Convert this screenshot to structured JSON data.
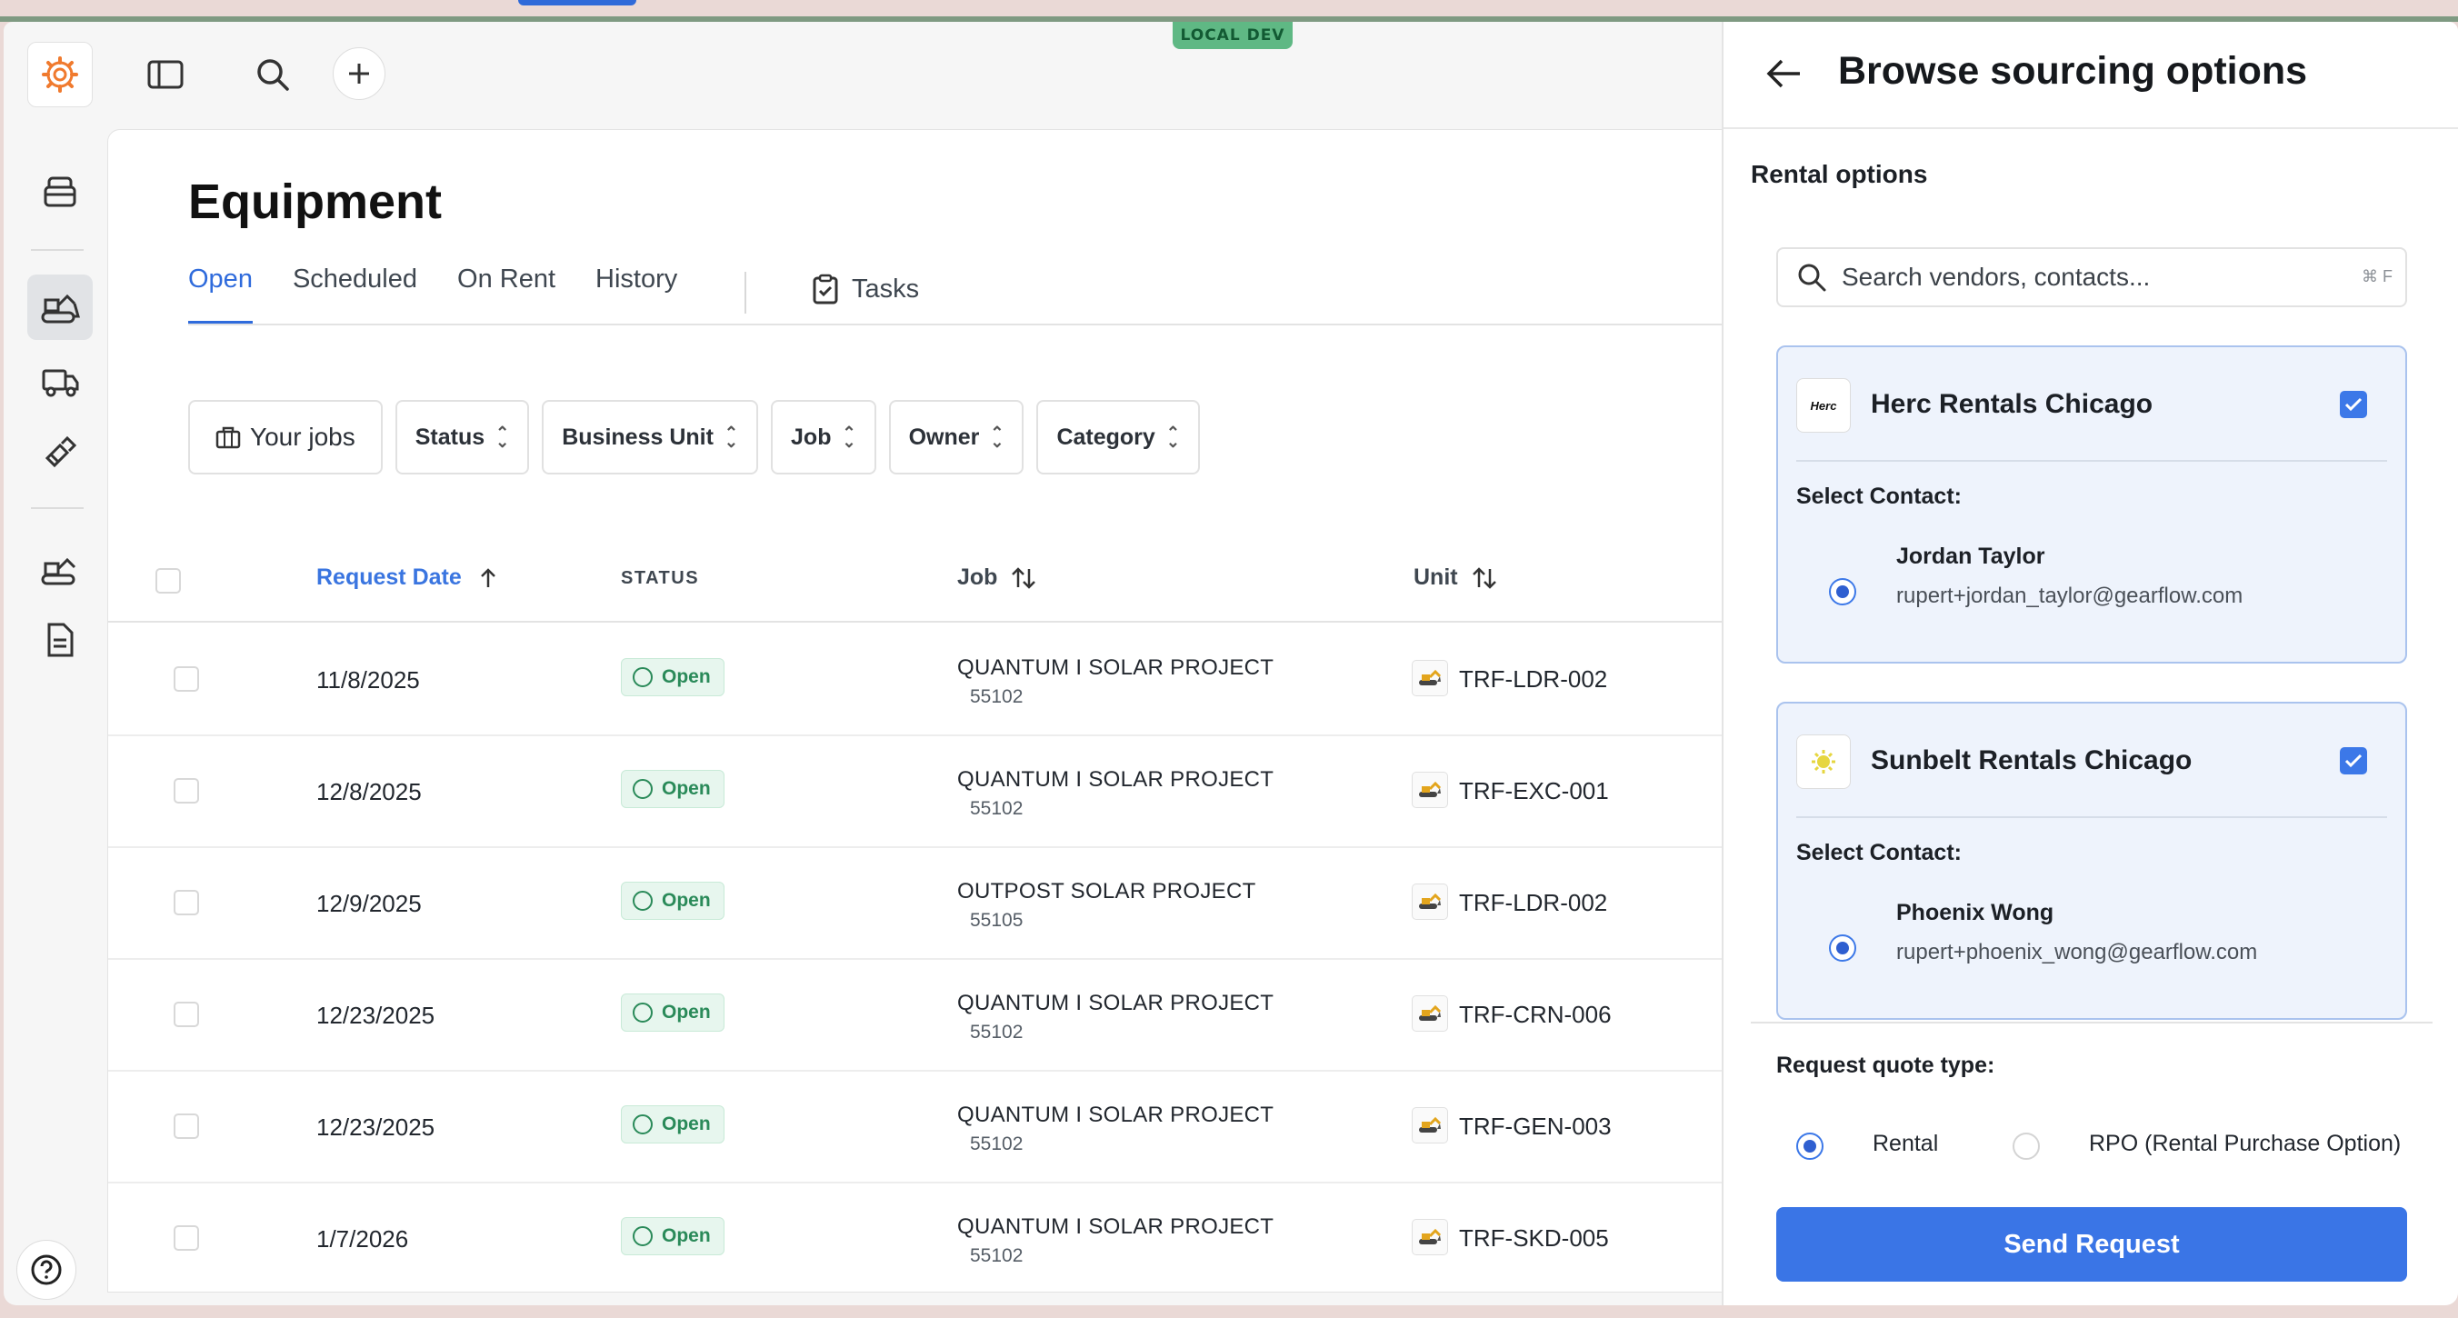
{
  "env_badge": "LOCAL DEV",
  "colors": {
    "accent": "#3a75e6",
    "open_status": "#2a8a59",
    "rail_active": "#e1e3e6"
  },
  "topbar": {
    "icons": [
      "gearflow-logo-icon",
      "sidebar-toggle-icon",
      "search-icon",
      "plus-icon"
    ]
  },
  "rail": {
    "items": [
      "inventory-icon",
      "equipment-icon",
      "truck-icon",
      "tools-icon",
      "excavator-icon",
      "document-icon"
    ],
    "active": "equipment-icon",
    "help": "help-icon"
  },
  "page": {
    "title": "Equipment",
    "tabs": [
      "Open",
      "Scheduled",
      "On Rent",
      "History"
    ],
    "active_tab": "Open",
    "tasks_tab": "Tasks"
  },
  "filters": {
    "your_jobs": "Your jobs",
    "status": "Status",
    "business_unit": "Business Unit",
    "job": "Job",
    "owner": "Owner",
    "category": "Category"
  },
  "table": {
    "headers": {
      "request_date": "Request Date",
      "status": "STATUS",
      "job": "Job",
      "unit": "Unit"
    },
    "rows": [
      {
        "date": "11/8/2025",
        "status": "Open",
        "job": "QUANTUM I SOLAR PROJECT",
        "job_no": "55102",
        "unit": "TRF-LDR-002"
      },
      {
        "date": "12/8/2025",
        "status": "Open",
        "job": "QUANTUM I SOLAR PROJECT",
        "job_no": "55102",
        "unit": "TRF-EXC-001"
      },
      {
        "date": "12/9/2025",
        "status": "Open",
        "job": "OUTPOST SOLAR PROJECT",
        "job_no": "55105",
        "unit": "TRF-LDR-002"
      },
      {
        "date": "12/23/2025",
        "status": "Open",
        "job": "QUANTUM I SOLAR PROJECT",
        "job_no": "55102",
        "unit": "TRF-CRN-006"
      },
      {
        "date": "12/23/2025",
        "status": "Open",
        "job": "QUANTUM I SOLAR PROJECT",
        "job_no": "55102",
        "unit": "TRF-GEN-003"
      },
      {
        "date": "1/7/2026",
        "status": "Open",
        "job": "QUANTUM I SOLAR PROJECT",
        "job_no": "55102",
        "unit": "TRF-SKD-005"
      }
    ]
  },
  "panel": {
    "title": "Browse sourcing options",
    "section": "Rental options",
    "search_placeholder": "Search vendors, contacts...",
    "search_shortcut": "⌘ F",
    "vendors": [
      {
        "name": "Herc Rentals Chicago",
        "logo_text": "Herc",
        "selected": true,
        "contact_label": "Select Contact:",
        "contact_name": "Jordan Taylor",
        "contact_email": "rupert+jordan_taylor@gearflow.com"
      },
      {
        "name": "Sunbelt Rentals Chicago",
        "logo_text": "",
        "selected": true,
        "contact_label": "Select Contact:",
        "contact_name": "Phoenix Wong",
        "contact_email": "rupert+phoenix_wong@gearflow.com"
      }
    ],
    "quote_type_label": "Request quote type:",
    "quote_options": [
      "Rental",
      "RPO (Rental Purchase Option)"
    ],
    "quote_selected": "Rental",
    "send_button": "Send Request"
  }
}
